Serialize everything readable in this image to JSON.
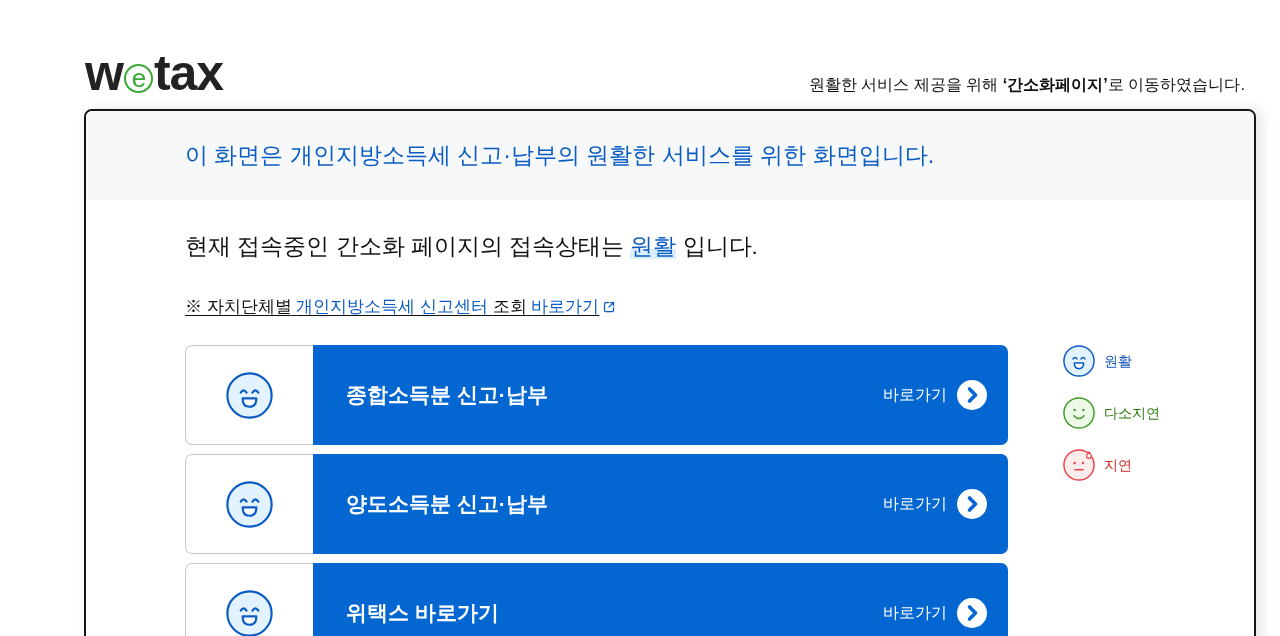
{
  "logo": {
    "before": "w",
    "mark": "e",
    "after": "tax"
  },
  "notice": "원활한 서비스 제공을 위해 **‘간소화페이지’**로 이동하였습니다.",
  "banner": "이 화면은 개인지방소득세 신고·납부의 원활한 서비스를 위한 화면입니다.",
  "status_message": {
    "before": "현재 접속중인 간소화 페이지의 접속상태는",
    "status_label": "원활",
    "after": "입니다."
  },
  "center_link": {
    "parts": [
      {
        "text": "※ 자치단체별",
        "accent": false
      },
      {
        "text": "개인지방소득세 신고센터",
        "accent": true
      },
      {
        "text": "조회",
        "accent": false
      },
      {
        "text": "바로가기",
        "accent": true
      }
    ]
  },
  "services": [
    {
      "title": "종합소득분 신고·납부",
      "kind": "smooth",
      "action": "바로가기"
    },
    {
      "title": "양도소득분 신고·납부",
      "kind": "smooth",
      "action": "바로가기"
    },
    {
      "title": "위택스 바로가기",
      "kind": "smooth",
      "action": "바로가기"
    }
  ],
  "legend": [
    {
      "label": "원활",
      "kind": "smooth"
    },
    {
      "label": "다소지연",
      "kind": "delayed"
    },
    {
      "label": "지연",
      "kind": "slow"
    }
  ]
}
